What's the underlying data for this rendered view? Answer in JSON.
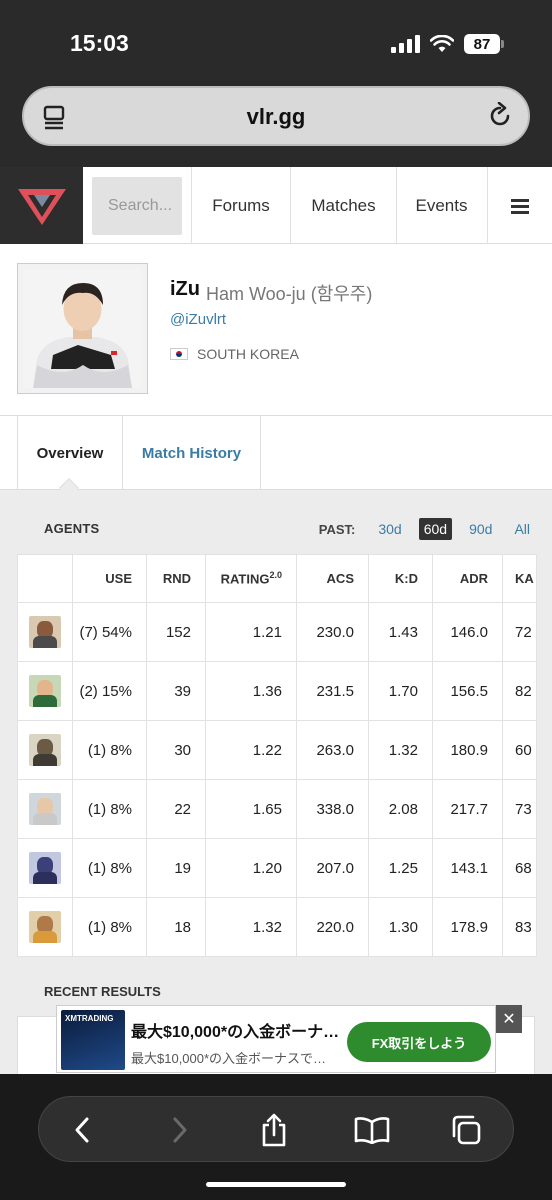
{
  "status_bar": {
    "time": "15:03",
    "battery": "87"
  },
  "address_bar": {
    "url": "vlr.gg"
  },
  "site_nav": {
    "search_placeholder": "Search...",
    "items": [
      "Forums",
      "Matches",
      "Events"
    ]
  },
  "player": {
    "alias": "iZu",
    "real_name": "Ham Woo-ju (함우주)",
    "handle": "@iZuvlrt",
    "country": "SOUTH KOREA"
  },
  "tabs": [
    "Overview",
    "Match History"
  ],
  "agents_section": {
    "title": "AGENTS",
    "past_label": "PAST:",
    "periods": [
      "30d",
      "60d",
      "90d",
      "All"
    ],
    "active_period": "60d",
    "columns": [
      "USE",
      "RND",
      "RATING",
      "ACS",
      "K:D",
      "ADR",
      "KA"
    ],
    "rating_sup": "2.0",
    "rows": [
      {
        "agent": "agent-1",
        "use": "(7) 54%",
        "rnd": "152",
        "rating": "1.21",
        "acs": "230.0",
        "kd": "1.43",
        "adr": "146.0",
        "kast": "72"
      },
      {
        "agent": "agent-2",
        "use": "(2) 15%",
        "rnd": "39",
        "rating": "1.36",
        "acs": "231.5",
        "kd": "1.70",
        "adr": "156.5",
        "kast": "82"
      },
      {
        "agent": "agent-3",
        "use": "(1) 8%",
        "rnd": "30",
        "rating": "1.22",
        "acs": "263.0",
        "kd": "1.32",
        "adr": "180.9",
        "kast": "60"
      },
      {
        "agent": "agent-4",
        "use": "(1) 8%",
        "rnd": "22",
        "rating": "1.65",
        "acs": "338.0",
        "kd": "2.08",
        "adr": "217.7",
        "kast": "73"
      },
      {
        "agent": "agent-5",
        "use": "(1) 8%",
        "rnd": "19",
        "rating": "1.20",
        "acs": "207.0",
        "kd": "1.25",
        "adr": "143.1",
        "kast": "68"
      },
      {
        "agent": "agent-6",
        "use": "(1) 8%",
        "rnd": "18",
        "rating": "1.32",
        "acs": "220.0",
        "kd": "1.30",
        "adr": "178.9",
        "kast": "83"
      }
    ]
  },
  "recent_results": {
    "title": "RECENT RESULTS"
  },
  "ad": {
    "brand": "XMTRADING",
    "title": "最大$10,000*の入金ボーナ…",
    "subtitle": "最大$10,000*の入金ボーナスで…",
    "cta": "FX取引をしよう",
    "close": "✕"
  },
  "colors": {
    "link": "#3a7ca5",
    "logo_red": "#e0505a",
    "ad_green": "#2e8b2e"
  }
}
